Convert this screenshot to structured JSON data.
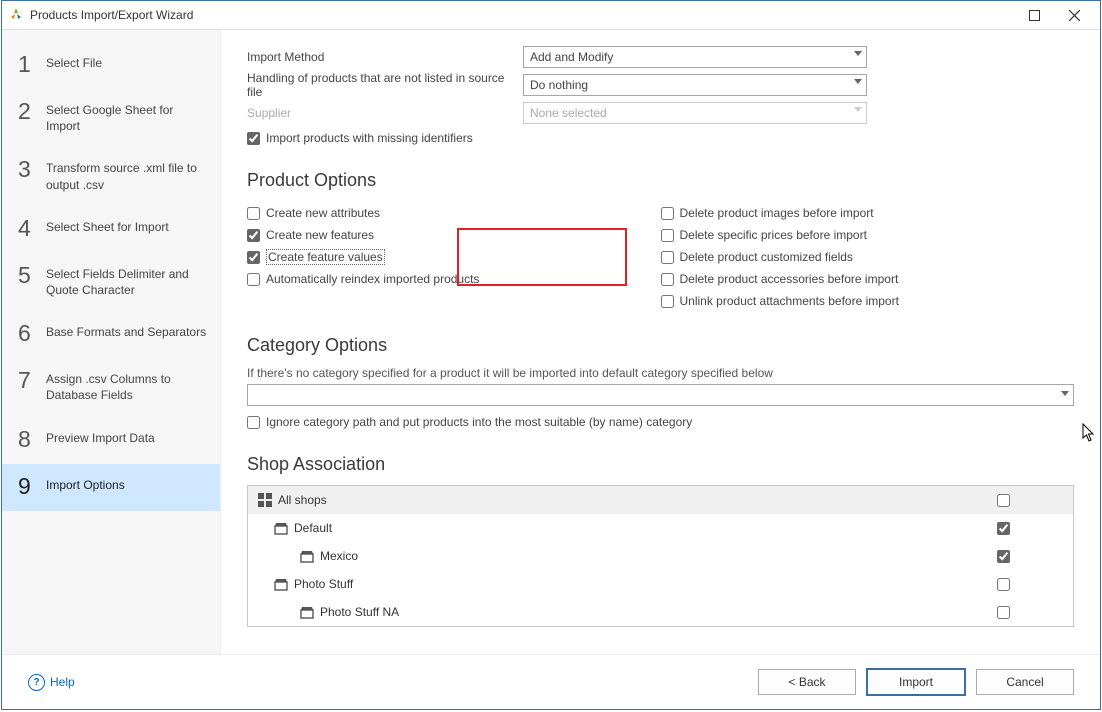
{
  "window": {
    "title": "Products Import/Export Wizard"
  },
  "sidebar": {
    "steps": [
      {
        "num": "1",
        "label": "Select File"
      },
      {
        "num": "2",
        "label": "Select Google Sheet for Import"
      },
      {
        "num": "3",
        "label": "Transform source .xml file to output .csv"
      },
      {
        "num": "4",
        "label": "Select Sheet for Import"
      },
      {
        "num": "5",
        "label": "Select Fields Delimiter and Quote Character"
      },
      {
        "num": "6",
        "label": "Base Formats and Separators"
      },
      {
        "num": "7",
        "label": "Assign .csv Columns to Database Fields"
      },
      {
        "num": "8",
        "label": "Preview Import Data"
      },
      {
        "num": "9",
        "label": "Import Options"
      }
    ],
    "active_index": 8
  },
  "form": {
    "import_method": {
      "label": "Import Method",
      "value": "Add and Modify"
    },
    "handling": {
      "label": "Handling of products that are not listed in source file",
      "value": "Do nothing"
    },
    "supplier": {
      "label": "Supplier",
      "value": "None selected"
    },
    "import_missing": {
      "label": "Import products with missing identifiers",
      "checked": true
    }
  },
  "product_options": {
    "title": "Product Options",
    "left": [
      {
        "label": "Create new attributes",
        "checked": false
      },
      {
        "label": "Create new features",
        "checked": true
      },
      {
        "label": "Create feature values",
        "checked": true,
        "dotted": true
      },
      {
        "label": "Automatically reindex imported products",
        "checked": false
      }
    ],
    "right": [
      {
        "label": "Delete product images before import",
        "checked": false
      },
      {
        "label": "Delete specific prices before import",
        "checked": false
      },
      {
        "label": "Delete product customized fields",
        "checked": false
      },
      {
        "label": "Delete product accessories before import",
        "checked": false
      },
      {
        "label": "Unlink product attachments before import",
        "checked": false
      }
    ]
  },
  "category_options": {
    "title": "Category Options",
    "note": "If there's no category specified for a product it will be imported into default category specified below",
    "ignore": {
      "label": "Ignore category path and put products into the most suitable (by name) category",
      "checked": false
    }
  },
  "shop": {
    "title": "Shop Association",
    "rows": [
      {
        "name": "All shops",
        "level": 0,
        "icon": "allshops",
        "checked": false,
        "head": true
      },
      {
        "name": "Default",
        "level": 1,
        "icon": "shop",
        "checked": true
      },
      {
        "name": "Mexico",
        "level": 2,
        "icon": "shop",
        "checked": true
      },
      {
        "name": "Photo Stuff",
        "level": 1,
        "icon": "shop",
        "checked": false
      },
      {
        "name": "Photo Stuff NA",
        "level": 2,
        "icon": "shop",
        "checked": false
      }
    ]
  },
  "footer": {
    "help": "Help",
    "back": "< Back",
    "import": "Import",
    "cancel": "Cancel"
  }
}
